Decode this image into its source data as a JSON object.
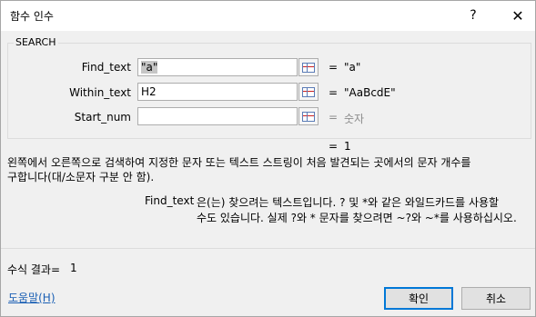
{
  "window": {
    "title": "함수 인수",
    "help_glyph": "?",
    "close_glyph": "✕"
  },
  "group": {
    "label": "SEARCH"
  },
  "args": [
    {
      "label": "Find_text",
      "value_selected": "\"a\"",
      "result": "\"a\""
    },
    {
      "label": "Within_text",
      "value": "H2",
      "result": "\"AaBcdE\""
    },
    {
      "label": "Start_num",
      "value": "",
      "result": "숫자"
    }
  ],
  "function_result": "1",
  "description": {
    "line1": "왼쪽에서 오른쪽으로 검색하여 지정한 문자 또는 텍스트 스트링이 처음 발견되는 곳에서의 문자 개수를",
    "line2": "구합니다(대/소문자 구분 안 함)."
  },
  "arg_help": {
    "name": "Find_text",
    "line1": "은(는) 찾으려는 텍스트입니다. ? 및 *와 같은 와일드카드를 사용할",
    "line2": "수도 있습니다. 실제 ?와 * 문자를 찾으려면 ~?와 ~*를 사용하십시오."
  },
  "formula_result": {
    "label": "수식 결과=",
    "value": "1"
  },
  "footer": {
    "help_link": "도움말(H)",
    "ok_label": "확인",
    "cancel_label": "취소"
  }
}
